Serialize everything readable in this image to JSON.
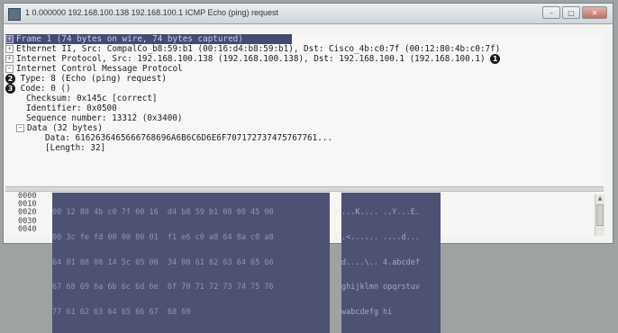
{
  "window": {
    "title": "1 0.000000 192.168.100.138 192.168.100.1 ICMP Echo (ping) request",
    "buttons": {
      "minimize": "–",
      "maximize": "□",
      "close": "✕"
    }
  },
  "tree": {
    "frame": "Frame 1 (74 bytes on wire, 74 bytes captured)",
    "ethernet": "Ethernet II, Src: CompalCo_b8:59:b1 (00:16:d4:b8:59:b1), Dst: Cisco_4b:c0:7f (00:12:80:4b:c0:7f)",
    "ip": "Internet Protocol, Src: 192.168.100.138 (192.168.100.138), Dst: 192.168.100.1 (192.168.100.1)",
    "icmp": "Internet Control Message Protocol",
    "type": "Type: 8 (Echo (ping) request)",
    "code": "Code: 0 ()",
    "checksum": "Checksum: 0x145c [correct]",
    "identifier": "Identifier: 0x0500",
    "sequence": "Sequence number: 13312 (0x3400)",
    "data": "Data (32 bytes)",
    "data_value": "Data: 6162636465666768696A6B6C6D6E6F707172737475767761...",
    "length": "[Length: 32]"
  },
  "badges": {
    "one": "1",
    "two": "2",
    "three": "3"
  },
  "hex": {
    "offsets": [
      "0000",
      "0010",
      "0020",
      "0030",
      "0040"
    ],
    "bytes": [
      "00 12 80 4b c0 7f 00 16  d4 b8 59 b1 08 00 45 00",
      "00 3c fe fd 00 00 80 01  f1 e6 c0 a8 64 8a c0 a8",
      "64 01 08 00 14 5c 05 00  34 00 61 62 63 64 65 66",
      "67 68 69 6a 6b 6c 6d 6e  6f 70 71 72 73 74 75 76",
      "77 61 62 63 64 65 66 67  68 69"
    ],
    "ascii": [
      "...K.... ..Y...E.",
      ".<...... ....d...",
      "d....\\.. 4.abcdef",
      "ghijklmn opqrstuv",
      "wabcdefg hi"
    ]
  }
}
